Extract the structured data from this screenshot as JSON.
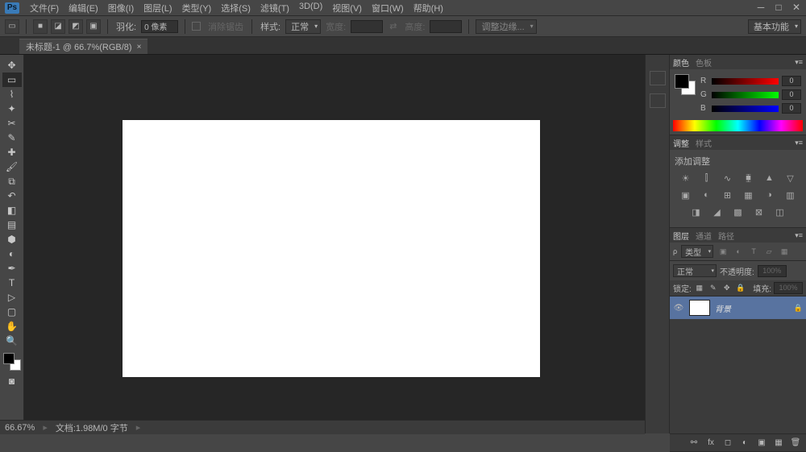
{
  "menubar": {
    "items": [
      "文件(F)",
      "编辑(E)",
      "图像(I)",
      "图层(L)",
      "类型(Y)",
      "选择(S)",
      "滤镜(T)",
      "3D(D)",
      "视图(V)",
      "窗口(W)",
      "帮助(H)"
    ]
  },
  "optionbar": {
    "feather_label": "羽化:",
    "feather_value": "0 像素",
    "antialias": "消除锯齿",
    "style_label": "样式:",
    "style_value": "正常",
    "width_label": "宽度:",
    "height_label": "高度:",
    "refine": "调整边缘...",
    "workspace": "基本功能"
  },
  "document": {
    "tab": "未标题-1 @ 66.7%(RGB/8)",
    "zoom": "66.67%",
    "status": "文档:1.98M/0 字节"
  },
  "panels": {
    "color": {
      "tab1": "颜色",
      "tab2": "色板",
      "r": "R",
      "g": "G",
      "b": "B",
      "rv": "0",
      "gv": "0",
      "bv": "0"
    },
    "adjust": {
      "tab1": "调整",
      "tab2": "样式",
      "title": "添加调整"
    },
    "layers": {
      "tab1": "图层",
      "tab2": "通道",
      "tab3": "路径",
      "kind": "类型",
      "blend": "正常",
      "opacity_label": "不透明度:",
      "opacity": "100%",
      "lock_label": "锁定:",
      "fill_label": "填充:",
      "fill": "100%",
      "layer_name": "背景"
    }
  }
}
